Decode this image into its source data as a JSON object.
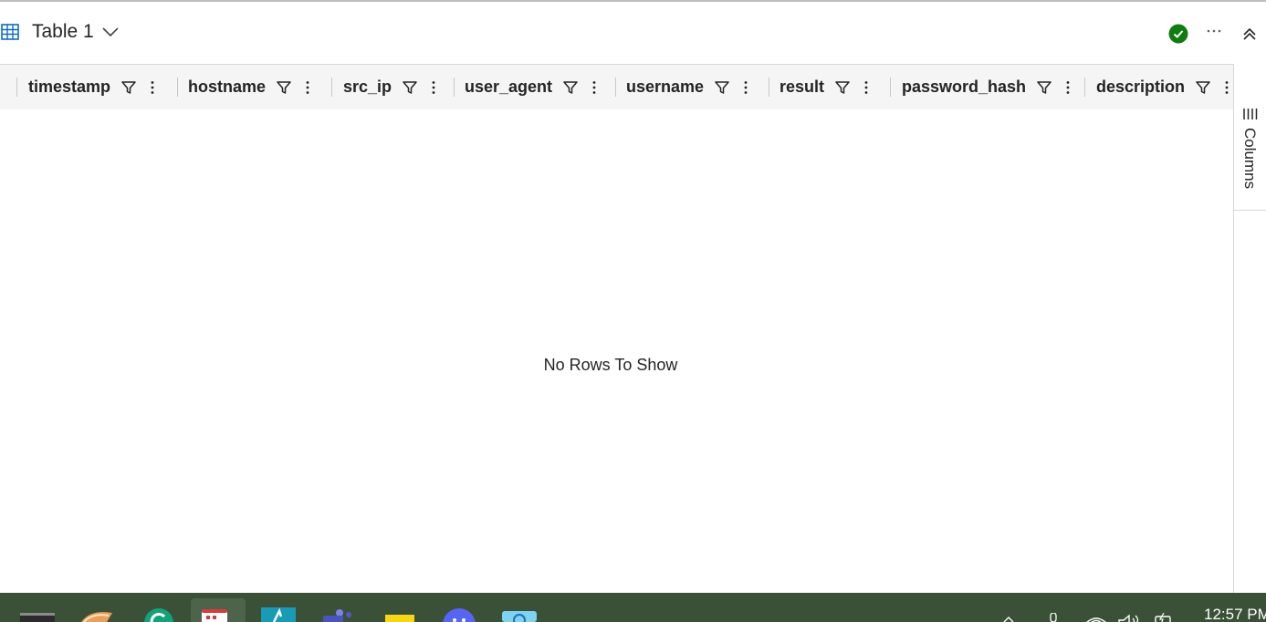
{
  "window": {
    "title": "Table 1"
  },
  "grid": {
    "columns": [
      {
        "label": "timestamp"
      },
      {
        "label": "hostname"
      },
      {
        "label": "src_ip"
      },
      {
        "label": "user_agent"
      },
      {
        "label": "username"
      },
      {
        "label": "result"
      },
      {
        "label": "password_hash"
      },
      {
        "label": "description"
      }
    ],
    "empty_message": "No Rows To Show"
  },
  "side_panel": {
    "columns_label": "Columns"
  },
  "taskbar": {
    "apps": [
      "terminal-icon",
      "pie-app-icon",
      "grammarly-icon",
      "calendar-icon",
      "jupyter-icon",
      "teams-icon",
      "sticky-notes-icon",
      "copilot-icon",
      "browser-icon"
    ],
    "tray": [
      "chevron-up-icon",
      "microphone-icon",
      "wifi-icon",
      "volume-icon",
      "battery-icon"
    ],
    "clock": "12:57 PM"
  },
  "colors": {
    "accent": "#0f6cbd",
    "status_ok": "#107c10",
    "taskbar": "#3a5137"
  }
}
